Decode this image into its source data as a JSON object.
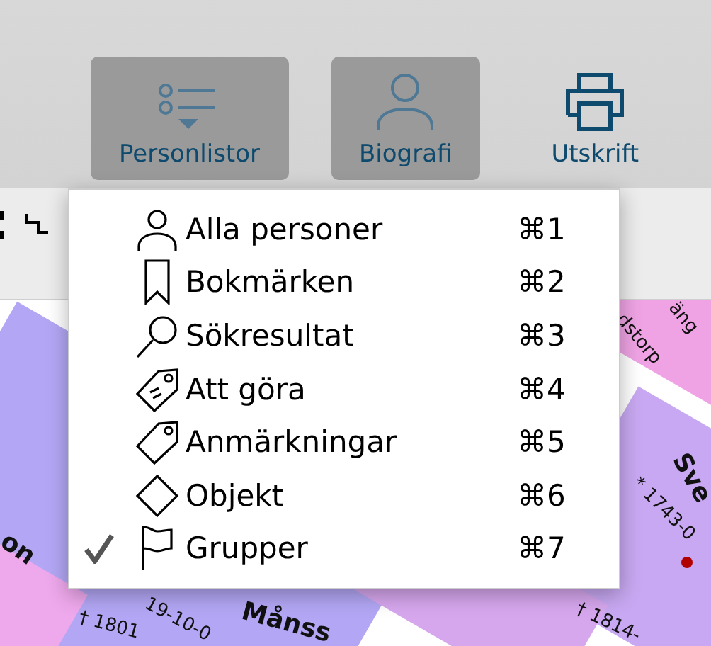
{
  "toolbar": {
    "buttons": [
      {
        "label": "Personlistor",
        "selected": true
      },
      {
        "label": "Biografi",
        "selected": true
      },
      {
        "label": "Utskrift",
        "selected": false
      }
    ]
  },
  "menu": {
    "items": [
      {
        "label": "Alla personer",
        "shortcut": "⌘1",
        "checked": false
      },
      {
        "label": "Bokmärken",
        "shortcut": "⌘2",
        "checked": false
      },
      {
        "label": "Sökresultat",
        "shortcut": "⌘3",
        "checked": false
      },
      {
        "label": "Att göra",
        "shortcut": "⌘4",
        "checked": false
      },
      {
        "label": "Anmärkningar",
        "shortcut": "⌘5",
        "checked": false
      },
      {
        "label": "Objekt",
        "shortcut": "⌘6",
        "checked": false
      },
      {
        "label": "Grupper",
        "shortcut": "⌘7",
        "checked": true
      }
    ]
  },
  "diagram": {
    "labels": [
      {
        "text": "on"
      },
      {
        "text": "äng"
      },
      {
        "text": "dstorp"
      },
      {
        "text": "Sve"
      },
      {
        "text": "† 1801"
      },
      {
        "text": "19-10-0"
      },
      {
        "text": "Månss"
      },
      {
        "text": "* 1743-0"
      },
      {
        "text": "† 1814-"
      }
    ]
  }
}
